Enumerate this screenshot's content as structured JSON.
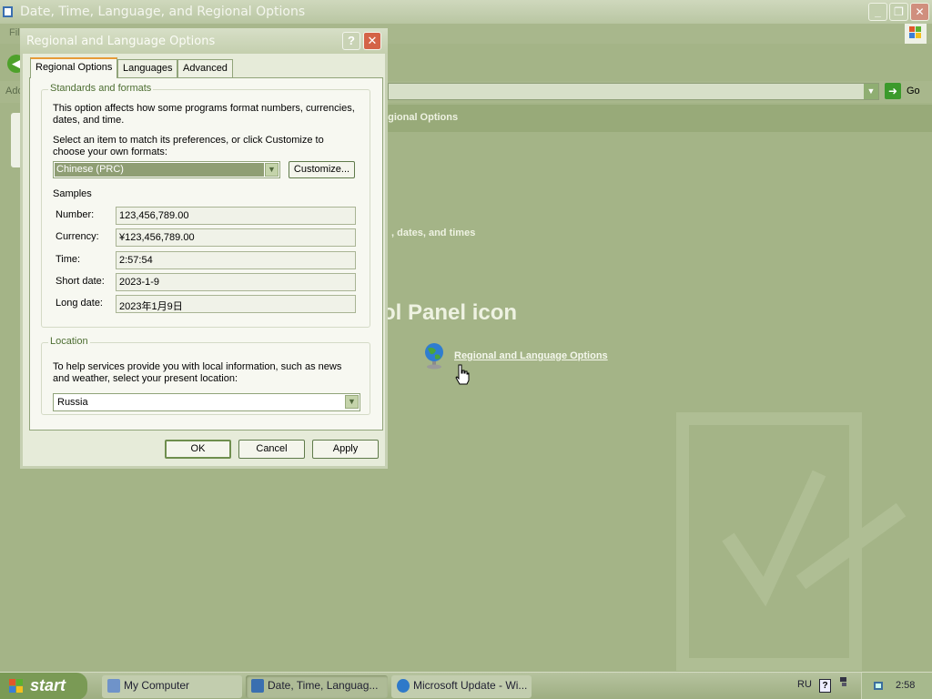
{
  "main_window": {
    "title": "Date, Time, Language, and Regional Options",
    "menu_file": "Fil",
    "address_label": "Add",
    "go_label": "Go",
    "header_text": "egional Options",
    "sub_heading": ", dates, and times",
    "pick_heading": "ol Panel icon",
    "cp_link": "Regional and Language Options"
  },
  "dialog": {
    "title": "Regional and Language Options",
    "help_label": "?",
    "close_label": "✕",
    "tabs": [
      {
        "label": "Regional Options"
      },
      {
        "label": "Languages"
      },
      {
        "label": "Advanced"
      }
    ],
    "standards": {
      "legend": "Standards and formats",
      "desc1": "This option affects how some programs format numbers, currencies, dates, and time.",
      "desc2": "Select an item to match its preferences, or click Customize to choose your own formats:",
      "format_value": "Chinese (PRC)",
      "customize_label": "Customize...",
      "samples_label": "Samples",
      "samples": [
        {
          "label": "Number:",
          "value": "123,456,789.00"
        },
        {
          "label": "Currency:",
          "value": "¥123,456,789.00"
        },
        {
          "label": "Time:",
          "value": "2:57:54"
        },
        {
          "label": "Short date:",
          "value": "2023-1-9"
        },
        {
          "label": "Long date:",
          "value": "2023年1月9日"
        }
      ]
    },
    "location": {
      "legend": "Location",
      "desc": "To help services provide you with local information, such as news and weather, select your present location:",
      "value": "Russia"
    },
    "buttons": {
      "ok": "OK",
      "cancel": "Cancel",
      "apply": "Apply"
    }
  },
  "taskbar": {
    "start_label": "start",
    "tasks": [
      {
        "label": "My Computer"
      },
      {
        "label": "Date, Time, Languag..."
      },
      {
        "label": "Microsoft Update - Wi..."
      }
    ],
    "tray_lang": "RU",
    "tray_help": "?",
    "clock": "2:58"
  },
  "colors": {
    "background": "#a4b487",
    "dialog_face": "#e6ebd9",
    "tab_accent": "#e79b37",
    "close_red": "#d46347",
    "selection": "#8f9e74"
  },
  "icons": [
    "window-icon",
    "minimize-icon",
    "maximize-icon",
    "close-icon",
    "back-arrow-icon",
    "go-arrow-icon",
    "globe-icon",
    "hand-cursor-icon",
    "windows-logo-icon",
    "help-icon",
    "computer-icon",
    "control-panel-icon",
    "ie-icon",
    "network-icon",
    "volume-icon"
  ]
}
